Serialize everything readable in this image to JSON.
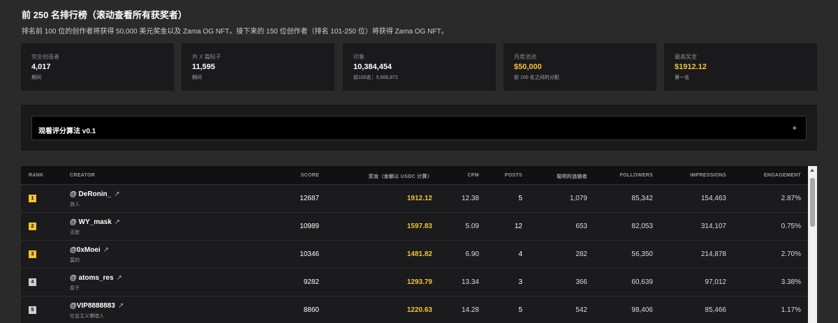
{
  "header": {
    "title": "前 250 名排行榜（滚动查看所有获奖者）",
    "subtitle": "排名前 100 位的创作者将获得 50,000 美元奖金以及 Zama OG NFT。接下来的 150 位创作者（排名 101-250 位）将获得 Zama OG NFT。"
  },
  "stats": [
    {
      "label": "完全创造者",
      "value": "4,017",
      "sub": "期间"
    },
    {
      "label": "共 X 篇帖子",
      "value": "11,595",
      "sub": "期间"
    },
    {
      "label": "印象",
      "value": "10,384,454",
      "sub": "前100名：5,606,872"
    },
    {
      "label": "月度池池",
      "value": "$50,000",
      "sub": "前 100 名之间的分配"
    },
    {
      "label": "最高奖金",
      "value": "$1912.12",
      "sub": "第一名"
    }
  ],
  "algorithm": {
    "label": "观看评分算法 v0.1",
    "toggle": "+"
  },
  "table": {
    "headers": {
      "rank": "RANK",
      "creator": "CREATOR",
      "score": "SCORE",
      "prize": "奖金（金额以 USDC 计算）",
      "cpm": "CPM",
      "posts": "POSTS",
      "smart": "聪明的追随者",
      "followers": "FOLLOWERS",
      "impressions": "IMPRESSIONS",
      "engagement": "ENGAGEMENT"
    },
    "rows": [
      {
        "rank": "1",
        "creator": "@ DeRonin_",
        "arrow": "↗",
        "tag": "浪人",
        "score": "12687",
        "prize": "1912.12",
        "cpm": "12.38",
        "posts": "5",
        "smart": "1,079",
        "followers": "85,342",
        "impressions": "154,463",
        "engagement": "2.87%"
      },
      {
        "rank": "2",
        "creator": "@ WY_mask",
        "arrow": "↗",
        "tag": "无脸",
        "score": "10989",
        "prize": "1597.83",
        "cpm": "5.09",
        "posts": "12",
        "smart": "653",
        "followers": "82,053",
        "impressions": "314,107",
        "engagement": "0.75%"
      },
      {
        "rank": "3",
        "creator": "@0xMoei",
        "arrow": "↗",
        "tag": "莫的",
        "score": "10346",
        "prize": "1481.82",
        "cpm": "6.90",
        "posts": "4",
        "smart": "282",
        "followers": "56,350",
        "impressions": "214,878",
        "engagement": "2.70%"
      },
      {
        "rank": "4",
        "creator": "@ atoms_res",
        "arrow": "↗",
        "tag": "原子",
        "score": "9282",
        "prize": "1293.79",
        "cpm": "13.34",
        "posts": "3",
        "smart": "366",
        "followers": "60,639",
        "impressions": "97,012",
        "engagement": "3.38%"
      },
      {
        "rank": "5",
        "creator": "@VIP8888883",
        "arrow": "↗",
        "tag": "社会主义懒暗人",
        "score": "8860",
        "prize": "1220.63",
        "cpm": "14.28",
        "posts": "5",
        "smart": "542",
        "followers": "98,406",
        "impressions": "85,466",
        "engagement": "1.17%"
      }
    ]
  },
  "colors": {
    "accent": "#f4c430",
    "background": "#2a2a2b",
    "panel": "#1a1a1c"
  }
}
